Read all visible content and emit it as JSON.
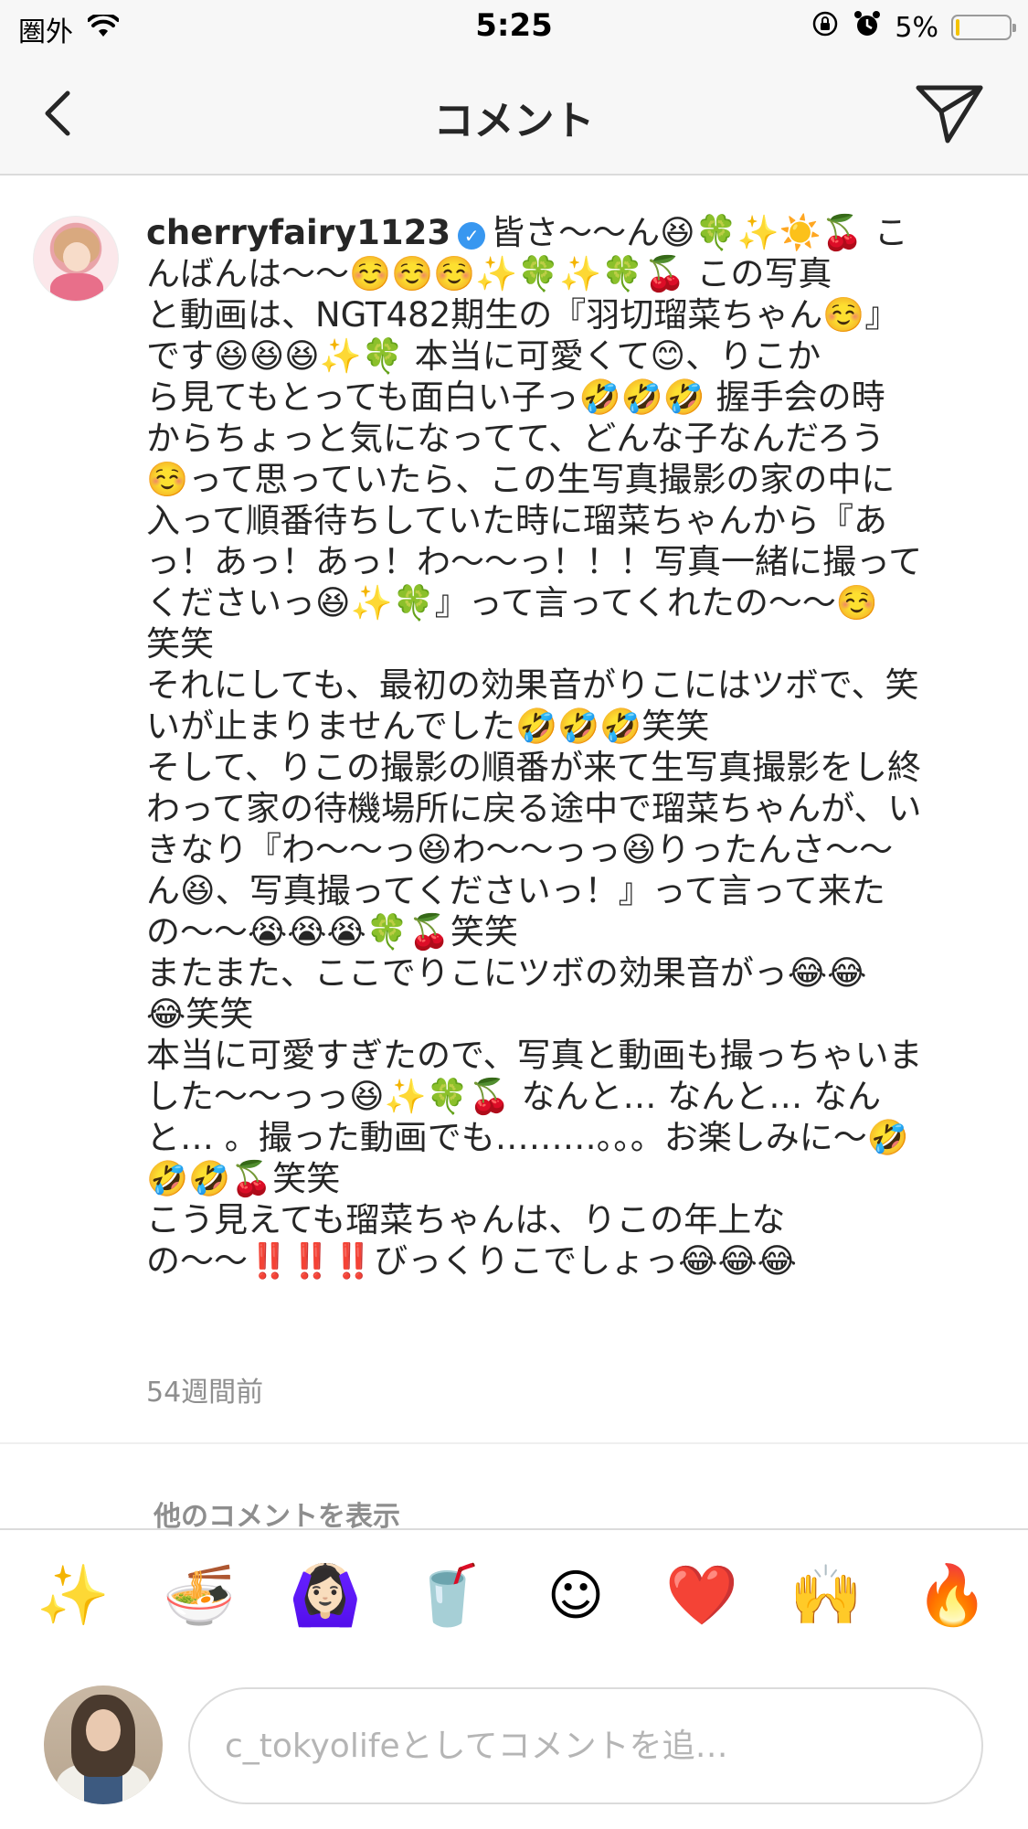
{
  "status_bar": {
    "carrier": "圏外",
    "time": "5:25",
    "battery_percent": "5%",
    "battery_level": 0.05,
    "battery_color": "#f4c300"
  },
  "navbar": {
    "title": "コメント",
    "back_icon": "chevron-left-icon",
    "send_icon": "paper-plane-icon"
  },
  "comment": {
    "username": "cherryfairy1123",
    "verified_icon": "verified-badge-icon",
    "lines": [
      "皆さ〜〜ん😆🍀✨☀️🍒 こ",
      "んばんは〜〜☺️☺️☺️✨🍀✨🍀🍒 この写真",
      "と動画は、NGT482期生の『羽切瑠菜ちゃん☺️』",
      "です😆😆😆✨🍀 本当に可愛くて😊、りこか",
      "ら見てもとっても面白い子っ🤣🤣🤣 握手会の時",
      "からちょっと気になってて、どんな子なんだろう",
      "☺️って思っていたら、この生写真撮影の家の中に",
      "入って順番待ちしていた時に瑠菜ちゃんから『あ",
      "っ！あっ！あっ！わ〜〜っ！！！写真一緒に撮って",
      "くださいっ😆✨🍀』って言ってくれたの〜〜☺️",
      "笑笑",
      "それにしても、最初の効果音がりこにはツボで、笑",
      "いが止まりませんでした🤣🤣🤣笑笑",
      "そして、りこの撮影の順番が来て生写真撮影をし終",
      "わって家の待機場所に戻る途中で瑠菜ちゃんが、い",
      "きなり『わ〜〜っ😆わ〜〜っっ😆りったんさ〜〜",
      "ん😆、写真撮ってくださいっ！』って言って来た",
      "の〜〜😭😭😭🍀🍒笑笑",
      "またまた、ここでりこにツボの効果音がっ😂😂",
      "😂笑笑",
      "本当に可愛すぎたので、写真と動画も撮っちゃいま",
      "した〜〜っっ😆✨🍀🍒 なんと… なんと… なん",
      "と… 。撮った動画でも………。。。お楽しみに〜🤣",
      "🤣🤣🍒笑笑",
      "こう見えても瑠菜ちゃんは、りこの年上な",
      "の〜〜‼️‼️‼️びっくりこでしょっ😂😂😂"
    ],
    "timestamp": "54週間前"
  },
  "more_comments_label": "他のコメントを表示",
  "emoji_bar": [
    {
      "char": "✨",
      "name": "sparkles-emoji"
    },
    {
      "char": "🍜",
      "name": "ramen-emoji"
    },
    {
      "char": "🙆🏻‍♀️",
      "name": "ok-gesture-emoji"
    },
    {
      "char": "🥤",
      "name": "cup-emoji"
    },
    {
      "char": "☺︎",
      "name": "smiley-emoji"
    },
    {
      "char": "❤️",
      "name": "heart-emoji"
    },
    {
      "char": "🙌",
      "name": "raised-hands-emoji"
    },
    {
      "char": "🔥",
      "name": "fire-emoji"
    }
  ],
  "input": {
    "placeholder": "c_tokyolifeとしてコメントを追…"
  }
}
